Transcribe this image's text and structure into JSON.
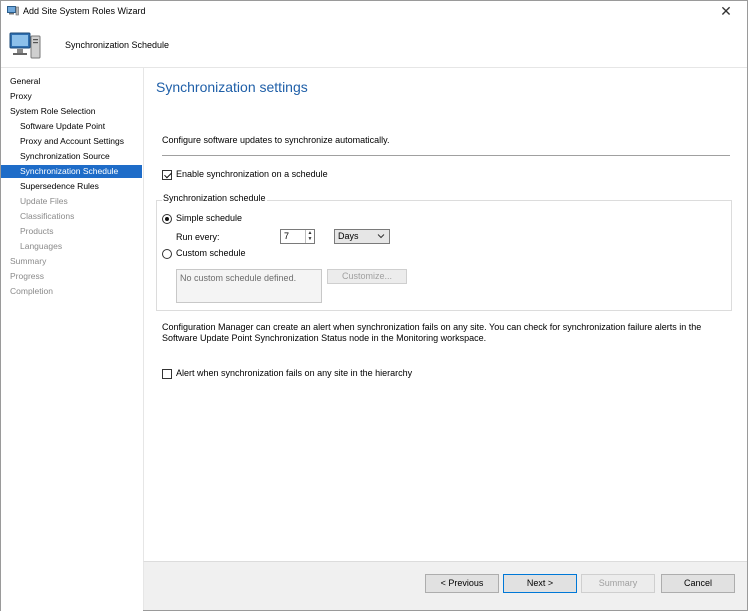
{
  "window": {
    "title": "Add Site System Roles Wizard",
    "close_glyph": "✕"
  },
  "header": {
    "title": "Synchronization Schedule"
  },
  "sidebar": {
    "items": [
      {
        "label": "General"
      },
      {
        "label": "Proxy"
      },
      {
        "label": "System Role Selection"
      },
      {
        "label": "Software Update Point"
      },
      {
        "label": "Proxy and Account Settings"
      },
      {
        "label": "Synchronization Source"
      },
      {
        "label": "Synchronization Schedule"
      },
      {
        "label": "Supersedence Rules"
      },
      {
        "label": "Update Files"
      },
      {
        "label": "Classifications"
      },
      {
        "label": "Products"
      },
      {
        "label": "Languages"
      },
      {
        "label": "Summary"
      },
      {
        "label": "Progress"
      },
      {
        "label": "Completion"
      }
    ]
  },
  "main": {
    "title": "Synchronization settings",
    "description": "Configure software updates to synchronize automatically.",
    "enable_sync_label": "Enable synchronization on a schedule",
    "group_title": "Synchronization schedule",
    "simple_label": "Simple schedule",
    "run_every_label": "Run every:",
    "run_every_value": "7",
    "unit_value": "Days",
    "custom_label": "Custom schedule",
    "custom_placeholder": "No custom schedule defined.",
    "customize_button": "Customize...",
    "note_line1": "Configuration Manager can create an alert when synchronization fails on any site. You can check for synchronization failure alerts in the",
    "note_line2": "Software Update Point Synchronization Status node in the Monitoring workspace.",
    "alert_label": "Alert when synchronization fails on any site in the hierarchy"
  },
  "footer": {
    "previous": "< Previous",
    "next": "Next >",
    "summary": "Summary",
    "cancel": "Cancel"
  },
  "colors": {
    "accent": "#1e6cc8",
    "title_blue": "#1f5fa8",
    "disabled_text": "#8a8a8a"
  },
  "icons": {
    "title_bar": "wizard-computer-icon",
    "header": "computer-monitor-icon",
    "close": "close-icon",
    "dropdown": "chevron-down-icon"
  }
}
